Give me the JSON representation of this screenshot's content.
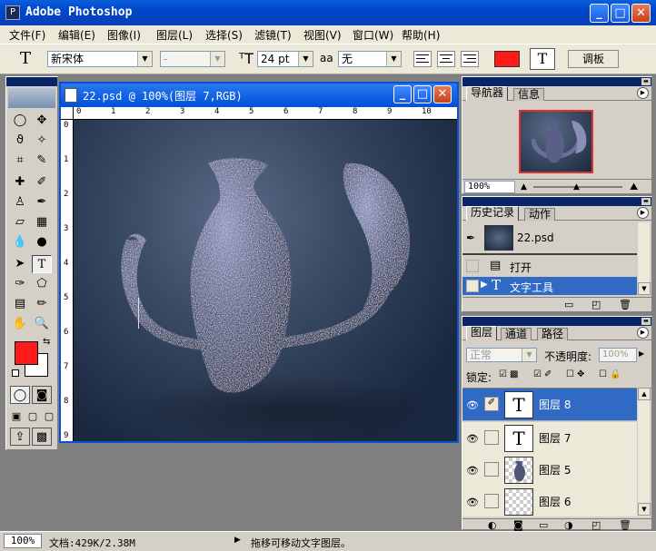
{
  "app": {
    "title": "Adobe Photoshop",
    "controls": {
      "min": "_",
      "max": "□",
      "close": "✕"
    }
  },
  "menu": [
    "文件(F)",
    "编辑(E)",
    "图像(I)",
    "图层(L)",
    "选择(S)",
    "滤镜(T)",
    "视图(V)",
    "窗口(W)",
    "帮助(H)"
  ],
  "options": {
    "tool_glyph": "T",
    "font_family": "新宋体",
    "font_style": "-",
    "font_size": "24 pt",
    "aa_label": "aa",
    "antialias": "无",
    "color_swatch": "#ff1a1a",
    "palette_button": "调板",
    "warp_glyph": "T"
  },
  "document": {
    "title": "22.psd @ 100%(图层 7,RGB)",
    "ruler_h": [
      "0",
      "1",
      "2",
      "3",
      "4",
      "5",
      "6",
      "7",
      "8",
      "9",
      "10"
    ],
    "ruler_v": [
      "0",
      "1",
      "2",
      "3",
      "4",
      "5",
      "6",
      "7",
      "8",
      "9"
    ]
  },
  "navigator": {
    "tabs": [
      "导航器",
      "信息"
    ],
    "zoom": "100%"
  },
  "history": {
    "tabs": [
      "历史记录",
      "动作"
    ],
    "snapshot": "22.psd",
    "items": [
      "打开",
      "文字工具"
    ]
  },
  "layers": {
    "tabs": [
      "图层",
      "通道",
      "路径"
    ],
    "blend_mode": "正常",
    "opacity_label": "不透明度:",
    "opacity": "100%",
    "lock_label": "锁定:",
    "rows": [
      {
        "name": "图层 8",
        "thumb": "T"
      },
      {
        "name": "图层 7",
        "thumb": "T"
      },
      {
        "name": "图层 5",
        "thumb": "vase"
      },
      {
        "name": "图层 6",
        "thumb": "checker"
      }
    ]
  },
  "status": {
    "zoom": "100%",
    "doc_info": "文档:429K/2.38M",
    "hint": "拖移可移动文字图层。"
  }
}
